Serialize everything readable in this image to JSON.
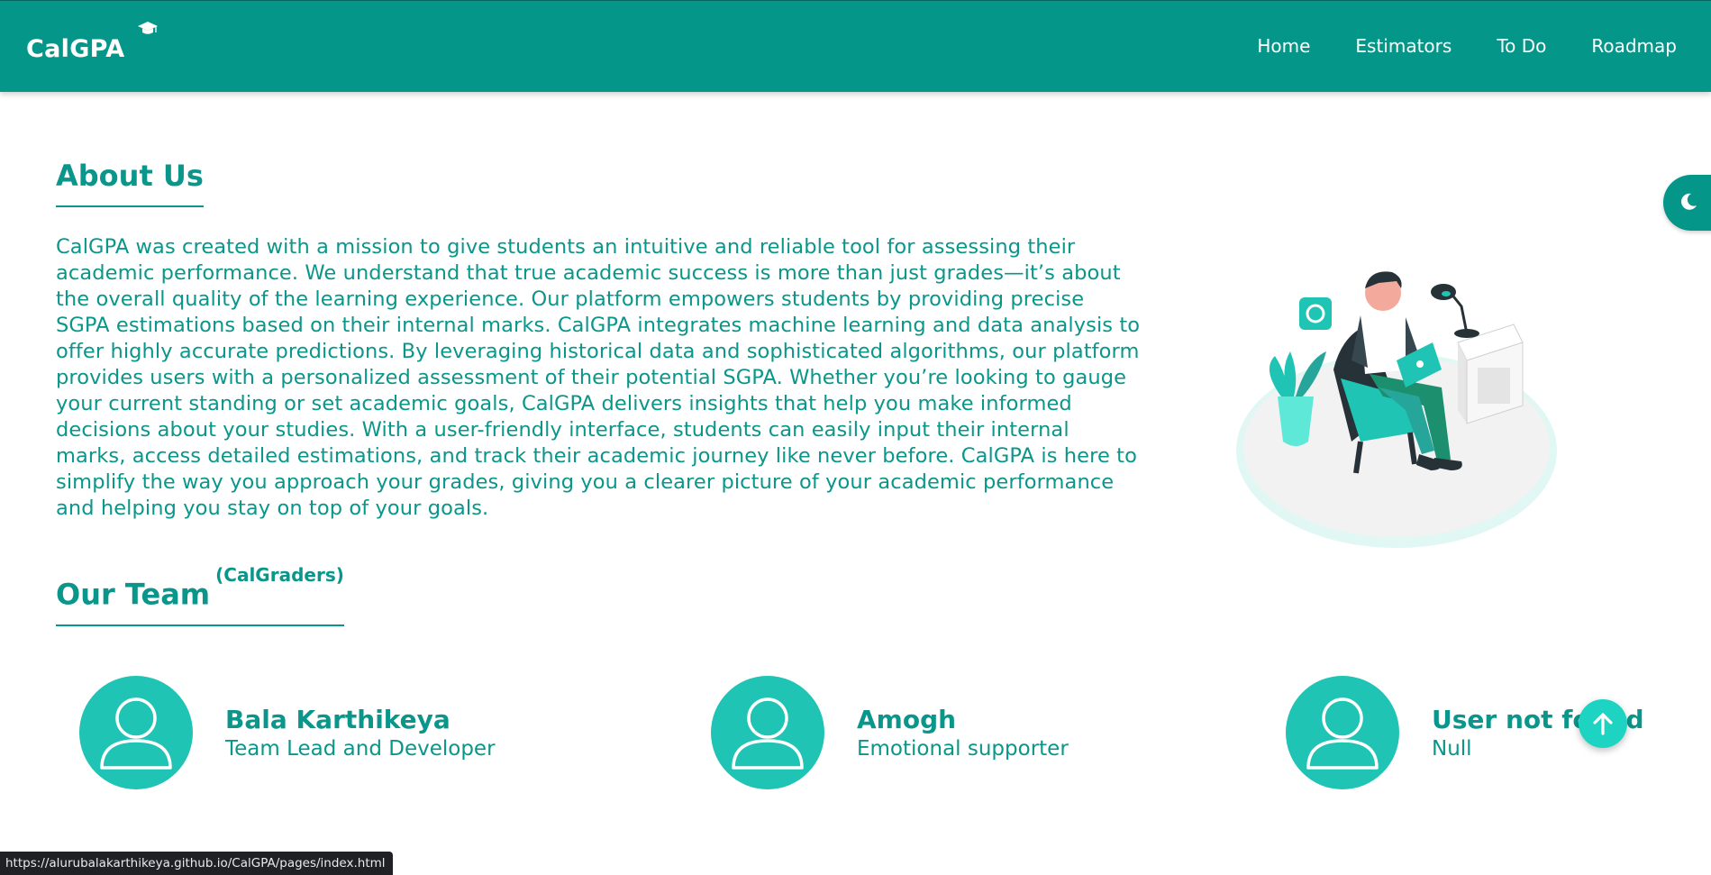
{
  "navbar": {
    "brand": "CalGPA",
    "brand_icon": "graduation-cap-icon",
    "links": [
      "Home",
      "Estimators",
      "To Do",
      "Roadmap"
    ]
  },
  "about": {
    "title": "About Us",
    "text": "CalGPA was created with a mission to give students an intuitive and reliable tool for assessing their academic performance. We understand that true academic success is more than just grades—it’s about the overall quality of the learning experience. Our platform empowers students by providing precise SGPA estimations based on their internal marks. CalGPA integrates machine learning and data analysis to offer highly accurate predictions. By leveraging historical data and sophisticated algorithms, our platform provides users with a personalized assessment of their potential SGPA. Whether you’re looking to gauge your current standing or set academic goals, CalGPA delivers insights that help you make informed decisions about your studies. With a user-friendly interface, students can easily input their internal marks, access detailed estimations, and track their academic journey like never before. CalGPA is here to simplify the way you approach your grades, giving you a clearer picture of your academic performance and helping you stay on top of your goals."
  },
  "team": {
    "title": "Our Team",
    "subtitle": "(CalGraders)",
    "members": [
      {
        "name": "Bala Karthikeya",
        "role": "Team Lead and Developer"
      },
      {
        "name": "Amogh",
        "role": "Emotional supporter"
      },
      {
        "name": "User not found",
        "role": "Null"
      }
    ]
  },
  "status_bar": {
    "url": "https://alurubalakarthikeya.github.io/CalGPA/pages/index.html"
  },
  "colors": {
    "primary": "#049789",
    "text": "#0a968a",
    "avatar": "#1fc4b4",
    "scroll_button": "#1dd4c2"
  }
}
